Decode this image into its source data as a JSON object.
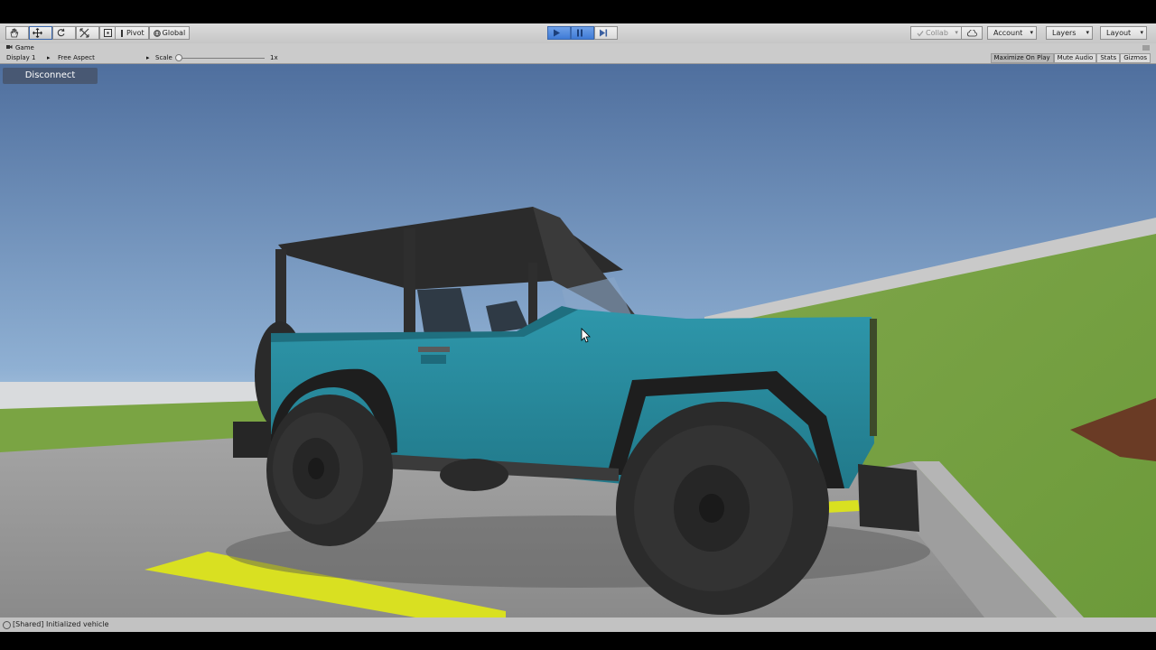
{
  "toolbar": {
    "pivot_label": "Pivot",
    "global_label": "Global",
    "collab_label": "Collab",
    "account_label": "Account",
    "layers_label": "Layers",
    "layout_label": "Layout"
  },
  "game_view": {
    "tab_label": "Game",
    "display_label": "Display 1",
    "aspect_label": "Free Aspect",
    "scale_label": "Scale",
    "scale_value": "1x",
    "maximize_label": "Maximize On Play",
    "mute_label": "Mute Audio",
    "stats_label": "Stats",
    "gizmos_label": "Gizmos"
  },
  "scene": {
    "disconnect_label": "Disconnect",
    "vehicle_color": "#2b8fa3",
    "sky_top": "#4f6f9e",
    "sky_bottom": "#bcd3e6",
    "grass": "#7da443",
    "road_line": "#d9e021"
  },
  "status": {
    "message": "[Shared] Initialized vehicle"
  },
  "colors": {
    "play_active": "#3f7bd6"
  }
}
